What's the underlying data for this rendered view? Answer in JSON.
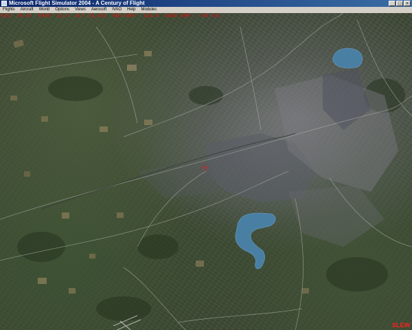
{
  "window": {
    "title": "Microsoft Flight Simulator 2004 - A Century of Flight",
    "buttons": {
      "minimize": "_",
      "maximize": "□",
      "close": "×"
    }
  },
  "menu": {
    "items": [
      "Flights",
      "Aircraft",
      "World",
      "Options",
      "Views",
      "Aerosoft",
      "IVAO",
      "Help",
      "Modules"
    ]
  },
  "status_readout": "N51° 29.67  E005° 31.4  ALT 33,452  HDG 000°  IAS 0  WIND 000° / 00 Kts",
  "mode_indicator": "SLEW",
  "colors": {
    "readout": "#e01010",
    "slew": "#ff2020",
    "titlebar": "#0a246a",
    "menubar": "#d4d0c8"
  },
  "icons": [
    "app-icon",
    "minimize-icon",
    "maximize-icon",
    "close-icon",
    "aircraft-marker-icon"
  ]
}
